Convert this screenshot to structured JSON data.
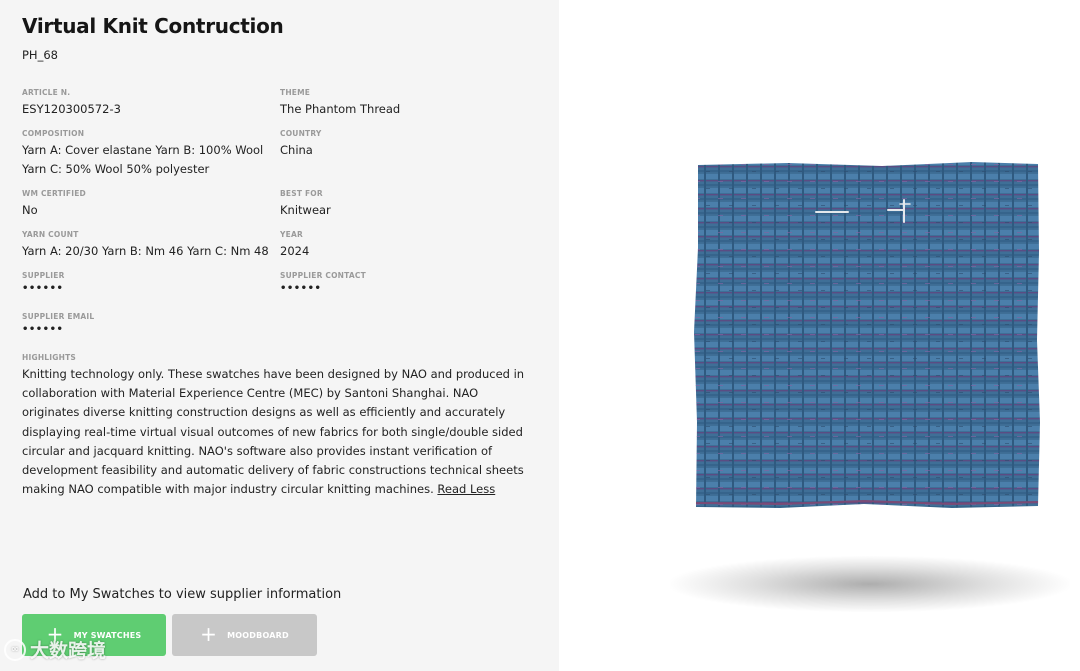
{
  "product": {
    "title": "Virtual Knit Contruction",
    "code": "PH_68"
  },
  "details": {
    "article": {
      "label": "ARTICLE N.",
      "value": "ESY120300572-3"
    },
    "theme": {
      "label": "THEME",
      "value": "The Phantom Thread"
    },
    "composition": {
      "label": "COMPOSITION",
      "value": "Yarn A: Cover elastane Yarn B: 100% Wool\nYarn C: 50% Wool 50% polyester"
    },
    "country": {
      "label": "COUNTRY",
      "value": "China"
    },
    "wm_certified": {
      "label": "WM CERTIFIED",
      "value": "No"
    },
    "best_for": {
      "label": "BEST FOR",
      "value": "Knitwear"
    },
    "yarn_count": {
      "label": "YARN COUNT",
      "value": "Yarn A: 20/30 Yarn B: Nm 46 Yarn C: Nm 48"
    },
    "year": {
      "label": "YEAR",
      "value": "2024"
    },
    "supplier": {
      "label": "SUPPLIER",
      "value": "••••••"
    },
    "supplier_contact": {
      "label": "SUPPLIER CONTACT",
      "value": "••••••"
    },
    "supplier_email": {
      "label": "SUPPLIER EMAIL",
      "value": "••••••"
    }
  },
  "highlights": {
    "label": "HIGHLIGHTS",
    "text": "Knitting technology only. These swatches have been designed by NAO and produced in collaboration with Material Experience Centre (MEC) by Santoni Shanghai. NAO originates diverse knitting construction designs as well as efficiently and accurately displaying real-time virtual visual outcomes of new fabrics for both single/double sided circular and jacquard knitting. NAO's software also provides instant verification of development feasibility and automatic delivery of fabric constructions technical sheets making NAO compatible with major industry circular knitting machines.",
    "read_less": "Read Less"
  },
  "cta": {
    "text": "Add to My Swatches to view supplier information",
    "my_swatches_label": "MY SWATCHES",
    "moodboard_label": "MOODBOARD"
  },
  "watermark": {
    "text": "大数跨境"
  },
  "colors": {
    "panel_bg": "#f5f5f5",
    "accent_green": "#5fcd72",
    "disabled_gray": "#c8c8c8",
    "fabric_blue": "#3f6f97"
  },
  "icons": {
    "add": "plus-icon",
    "watermark_logo": "watermark-logo-icon"
  }
}
